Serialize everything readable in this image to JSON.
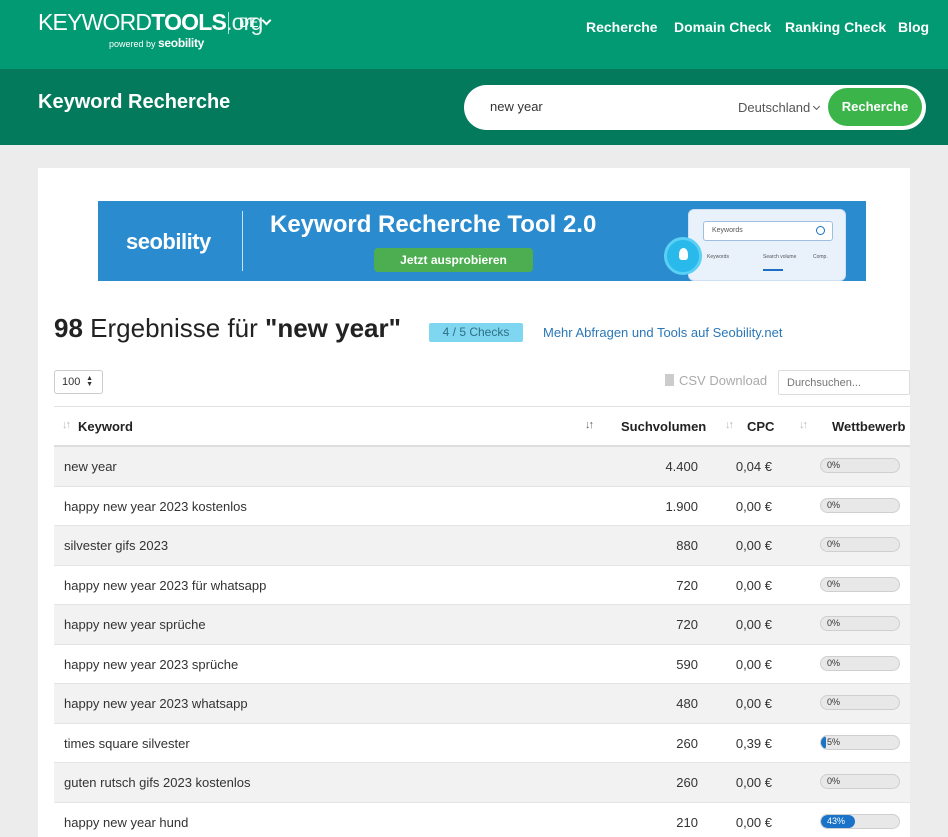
{
  "nav": {
    "logo_kw": "KEYWORD",
    "logo_tools": "TOOLS",
    "logo_org": ".org",
    "powered": "powered by",
    "powered_brand": "seobility",
    "lang": "DE",
    "links": [
      "Recherche",
      "Domain Check",
      "Ranking Check",
      "Blog"
    ]
  },
  "search": {
    "title": "Keyword Recherche",
    "query": "new year",
    "country": "Deutschland",
    "button": "Recherche"
  },
  "banner": {
    "brand": "seobility",
    "title": "Keyword Recherche Tool  2.0",
    "cta": "Jetzt ausprobieren",
    "mock_search": "Keywords",
    "mock_col1": "Keywords",
    "mock_col2": "Search volume",
    "mock_col3": "Comp."
  },
  "results": {
    "count": "98",
    "label": " Ergebnisse für ",
    "query": "\"new year\"",
    "checks": "4 / 5 Checks",
    "more_link": "Mehr Abfragen und Tools auf Seobility.net"
  },
  "controls": {
    "per_page": "100",
    "csv": "CSV Download",
    "filter_placeholder": "Durchsuchen..."
  },
  "table": {
    "headers": {
      "keyword": "Keyword",
      "volume": "Suchvolumen",
      "cpc": "CPC",
      "competition": "Wettbewerb"
    },
    "rows": [
      {
        "keyword": "new year",
        "volume": "4.400",
        "cpc": "0,04 €",
        "competition": "0%",
        "competition_value": 0
      },
      {
        "keyword": "happy new year 2023 kostenlos",
        "volume": "1.900",
        "cpc": "0,00 €",
        "competition": "0%",
        "competition_value": 0
      },
      {
        "keyword": "silvester gifs 2023",
        "volume": "880",
        "cpc": "0,00 €",
        "competition": "0%",
        "competition_value": 0
      },
      {
        "keyword": "happy new year 2023 für whatsapp",
        "volume": "720",
        "cpc": "0,00 €",
        "competition": "0%",
        "competition_value": 0
      },
      {
        "keyword": "happy new year sprüche",
        "volume": "720",
        "cpc": "0,00 €",
        "competition": "0%",
        "competition_value": 0
      },
      {
        "keyword": "happy new year 2023 sprüche",
        "volume": "590",
        "cpc": "0,00 €",
        "competition": "0%",
        "competition_value": 0
      },
      {
        "keyword": "happy new year 2023 whatsapp",
        "volume": "480",
        "cpc": "0,00 €",
        "competition": "0%",
        "competition_value": 0
      },
      {
        "keyword": "times square silvester",
        "volume": "260",
        "cpc": "0,39 €",
        "competition": "5%",
        "competition_value": 5
      },
      {
        "keyword": "guten rutsch gifs 2023 kostenlos",
        "volume": "260",
        "cpc": "0,00 €",
        "competition": "0%",
        "competition_value": 0
      },
      {
        "keyword": "happy new year hund",
        "volume": "210",
        "cpc": "0,00 €",
        "competition": "43%",
        "competition_value": 43
      }
    ]
  },
  "colors": {
    "nav_bg": "#019a72",
    "band_bg": "#027a5b",
    "search_button": "#3bb54a",
    "banner_bg": "#2a8ccf",
    "bar_fill": "#1a73c8",
    "link": "#2a77b8"
  }
}
